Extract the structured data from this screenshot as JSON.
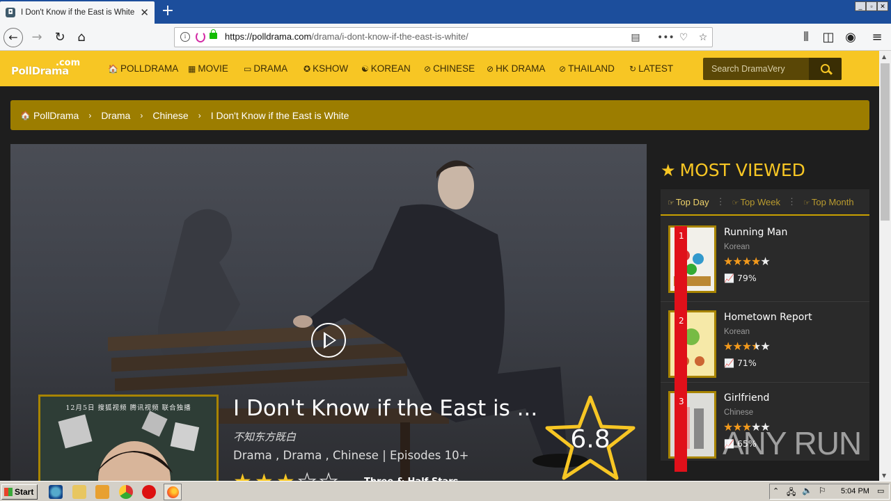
{
  "browser": {
    "tab_title": "I Don't Know if the East is White E",
    "tab_close": "✕",
    "new_tab": "+",
    "url_domain": "https://polldrama.com",
    "url_path": "/drama/i-dont-know-if-the-east-is-white/",
    "window_buttons": [
      "_",
      "▫",
      "✕"
    ]
  },
  "site": {
    "logo_main": "PollDrama",
    "logo_com": ".com",
    "menu": [
      {
        "icon": "🏠",
        "label": "POLLDRAMA"
      },
      {
        "icon": "▦",
        "label": "MOVIE"
      },
      {
        "icon": "▭",
        "label": "DRAMA"
      },
      {
        "icon": "✪",
        "label": "KSHOW"
      },
      {
        "icon": "☯",
        "label": "KOREAN"
      },
      {
        "icon": "⊘",
        "label": "CHINESE"
      },
      {
        "icon": "⊘",
        "label": "HK DRAMA"
      },
      {
        "icon": "⊘",
        "label": "THAILAND"
      },
      {
        "icon": "↻",
        "label": "LATEST"
      }
    ],
    "search_placeholder": "Search DramaVery"
  },
  "breadcrumb": {
    "home": "PollDrama",
    "items": [
      "Drama",
      "Chinese",
      "I Don't Know if the East is White"
    ],
    "separator": "›"
  },
  "show": {
    "title": "I Don't Know if the East is ...",
    "alt_name": "不知东方既白",
    "meta": "Drama , Drama , Chinese | Episodes 10+",
    "poster_caption": "12月5日  搜狐视频 腾讯视频 联合独播",
    "rating_label": "Three & Half Stars",
    "score": "6.8",
    "stars_filled": 3,
    "stars_total": 5
  },
  "most_viewed": {
    "title": "MOST VIEWED",
    "tabs": [
      "Top Day",
      "Top Week",
      "Top Month"
    ],
    "active_tab": 0,
    "items": [
      {
        "rank": "1",
        "name": "Running Man",
        "genre": "Korean",
        "stars": 4,
        "percent": "79%"
      },
      {
        "rank": "2",
        "name": "Hometown Report",
        "genre": "Korean",
        "stars": 3.5,
        "percent": "71%"
      },
      {
        "rank": "3",
        "name": "Girlfriend",
        "genre": "Chinese",
        "stars": 3,
        "percent": "65%"
      }
    ]
  },
  "watermark": "ANY RUN",
  "taskbar": {
    "start": "Start",
    "clock": "5:04 PM"
  },
  "colors": {
    "accent": "#f7c624",
    "breadcrumb_bg": "#9c7d00",
    "browser_tabbar": "#1c4e9c",
    "star_orange": "#f39a1c"
  }
}
